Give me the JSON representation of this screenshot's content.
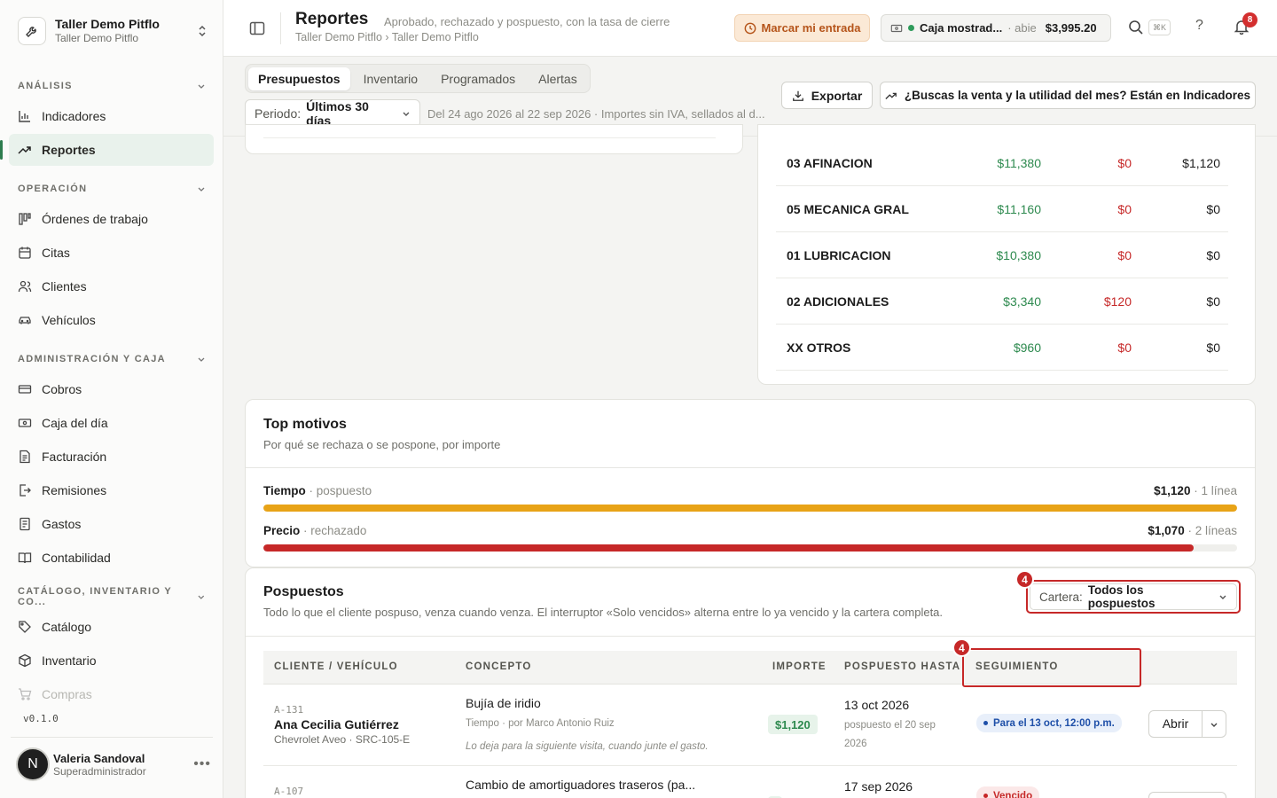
{
  "workspace": {
    "name": "Taller Demo Pitflo",
    "subtitle": "Taller Demo Pitflo"
  },
  "sidebar": {
    "sections": [
      {
        "label": "ANÁLISIS",
        "items": [
          {
            "label": "Indicadores",
            "icon": "bar-chart-icon"
          },
          {
            "label": "Reportes",
            "icon": "trend-icon",
            "active": true
          }
        ]
      },
      {
        "label": "OPERACIÓN",
        "items": [
          {
            "label": "Órdenes de trabajo",
            "icon": "kanban-icon"
          },
          {
            "label": "Citas",
            "icon": "calendar-icon"
          },
          {
            "label": "Clientes",
            "icon": "users-icon"
          },
          {
            "label": "Vehículos",
            "icon": "car-icon"
          }
        ]
      },
      {
        "label": "ADMINISTRACIÓN Y CAJA",
        "items": [
          {
            "label": "Cobros",
            "icon": "cash-icon"
          },
          {
            "label": "Caja del día",
            "icon": "register-icon"
          },
          {
            "label": "Facturación",
            "icon": "invoice-icon"
          },
          {
            "label": "Remisiones",
            "icon": "export-doc-icon"
          },
          {
            "label": "Gastos",
            "icon": "receipt-icon"
          },
          {
            "label": "Contabilidad",
            "icon": "book-icon"
          }
        ]
      },
      {
        "label": "CATÁLOGO, INVENTARIO Y CO...",
        "items": [
          {
            "label": "Catálogo",
            "icon": "tag-icon"
          },
          {
            "label": "Inventario",
            "icon": "box-icon"
          },
          {
            "label": "Compras",
            "icon": "cart-icon"
          }
        ]
      }
    ],
    "version": "v0.1.0",
    "user": {
      "initial": "N",
      "name": "Valeria Sandoval",
      "role": "Superadministrador"
    }
  },
  "topbar": {
    "title": "Reportes",
    "description": "Aprobado, rechazado y pospuesto, con la tasa de cierre",
    "breadcrumb": "Taller Demo Pitflo › Taller Demo Pitflo",
    "marcar_label": "Marcar mi entrada",
    "caja": {
      "name": "Caja mostrad...",
      "state": "abie",
      "amount": "$3,995.20"
    },
    "kbd": "⌘K",
    "help": "?",
    "notifications": "8"
  },
  "subheader": {
    "tabs": [
      "Presupuestos",
      "Inventario",
      "Programados",
      "Alertas"
    ],
    "periodo_label": "Periodo:",
    "periodo_value": "Últimos 30 días",
    "range_text": "Del 24 ago 2026 al 22 sep 2026 · Importes sin IVA, sellados al d...",
    "export_label": "Exportar",
    "indicadores_label": "¿Buscas la venta y la utilidad del mes? Están en Indicadores"
  },
  "categories": [
    {
      "name": "03 AFINACION",
      "v1": "$11,380",
      "v2": "$0",
      "v3": "$1,120"
    },
    {
      "name": "05 MECANICA GRAL",
      "v1": "$11,160",
      "v2": "$0",
      "v3": "$0"
    },
    {
      "name": "01 LUBRICACION",
      "v1": "$10,380",
      "v2": "$0",
      "v3": "$0"
    },
    {
      "name": "02 ADICIONALES",
      "v1": "$3,340",
      "v2": "$120",
      "v3": "$0"
    },
    {
      "name": "XX OTROS",
      "v1": "$960",
      "v2": "$0",
      "v3": "$0"
    }
  ],
  "motivos": {
    "title": "Top motivos",
    "subtitle": "Por qué se rechaza o se pospone, por importe",
    "rows": [
      {
        "name": "Tiempo",
        "kind": "· pospuesto",
        "amount": "$1,120",
        "count": "· 1 línea",
        "fill": 1.0,
        "color": "#e8a317"
      },
      {
        "name": "Precio",
        "kind": "· rechazado",
        "amount": "$1,070",
        "count": "· 2 líneas",
        "fill": 0.955,
        "color": "#c62828"
      }
    ]
  },
  "pospuestos": {
    "title": "Pospuestos",
    "subtitle": "Todo lo que el cliente pospuso, venza cuando venza. El interruptor «Solo vencidos» alterna entre lo ya vencido y la cartera completa.",
    "cartera_label": "Cartera:",
    "cartera_value": "Todos los pospuestos",
    "annotation": "4",
    "columns": [
      "CLIENTE / VEHÍCULO",
      "CONCEPTO",
      "IMPORTE",
      "POSPUESTO HASTA",
      "SEGUIMIENTO"
    ],
    "rows": [
      {
        "code": "A-131",
        "client": "Ana Cecilia Gutiérrez",
        "vehicle": "Chevrolet Aveo · SRC-105-E",
        "concept": "Bujía de iridio",
        "meta": "Tiempo  ·  por Marco Antonio Ruiz",
        "note": "Lo deja para la siguiente visita, cuando junte el gasto.",
        "amount": "$1,120",
        "date": "13 oct 2026",
        "date_meta": "pospuesto el 20 sep 2026",
        "status": "Para el 13 oct, 12:00 p.m.",
        "action": "Abrir"
      },
      {
        "code": "A-107",
        "concept": "Cambio de amortiguadores traseros (pa...",
        "date": "17 sep 2026",
        "status": "Vencido"
      }
    ]
  }
}
